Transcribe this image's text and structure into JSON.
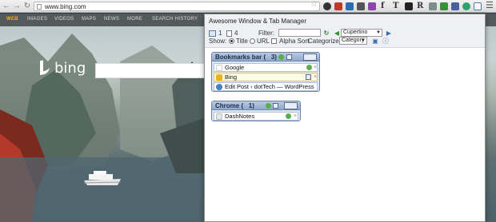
{
  "browser": {
    "url": "www.bing.com",
    "extension_glyphs": [
      "f",
      "T",
      "R"
    ]
  },
  "bing": {
    "nav": [
      "WEB",
      "IMAGES",
      "VIDEOS",
      "MAPS",
      "NEWS",
      "MORE",
      "SEARCH HISTORY"
    ],
    "logo_text": "bing"
  },
  "popup": {
    "title": "Awesome Window & Tab Manager",
    "window_count": "1",
    "tab_count": "4",
    "filter_label": "Filter:",
    "filter_value": "",
    "theme_select": "Cupertino",
    "show_label": "Show:",
    "show_title": "Title",
    "show_url": "URL",
    "alpha_sort": "Alpha Sort",
    "categorize_label": "Categorize:",
    "categorize_select": "Category",
    "groups": [
      {
        "title": "Bookmarks bar (",
        "count": "3)",
        "tabs": [
          {
            "label": "Google",
            "favicon_color": "#ffffff"
          },
          {
            "label": "Bing",
            "favicon_color": "#f2b01e"
          },
          {
            "label": "Edit Post ‹ dotTech — WordPress",
            "favicon_color": "#4a7fc0"
          }
        ]
      },
      {
        "title": "Chrome (",
        "count": "1)",
        "tabs": [
          {
            "label": "DashNotes",
            "favicon_color": "#e8e8e8"
          }
        ]
      }
    ]
  },
  "colors": {
    "bing_nav_active": "#f4b400",
    "group_header": "#91a9cd",
    "selected_tab": "#fffbe6"
  }
}
